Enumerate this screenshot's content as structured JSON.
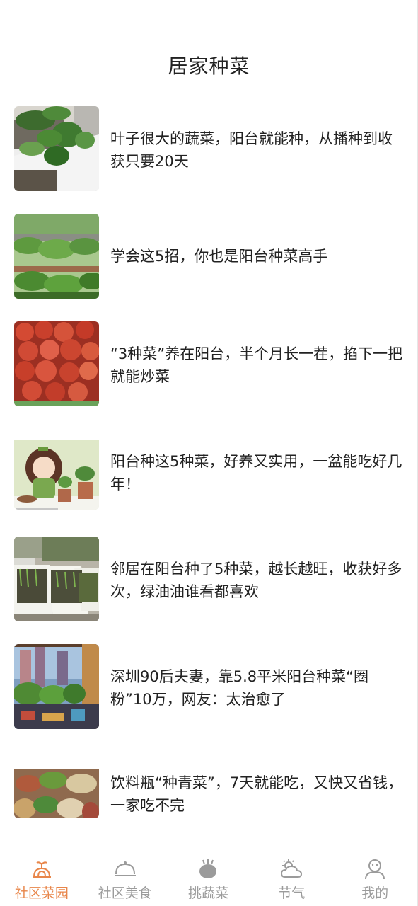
{
  "header": {
    "title": "居家种菜"
  },
  "articles": [
    {
      "title": "叶子很大的蔬菜，阳台就能种，从播种到收获只要20天"
    },
    {
      "title": "学会这5招，你也是阳台种菜高手"
    },
    {
      "title": "“3种菜”养在阳台，半个月长一茬，掐下一把就能炒菜"
    },
    {
      "title": "阳台种这5种菜，好养又实用，一盆能吃好几年！"
    },
    {
      "title": "邻居在阳台种了5种菜，越长越旺，收获好多次，绿油油谁看都喜欢"
    },
    {
      "title": "深圳90后夫妻，靠5.8平米阳台种菜“圈粉”10万，网友：太治愈了"
    },
    {
      "title": "饮料瓶“种青菜”，7天就能吃，又快又省钱，一家吃不完"
    }
  ],
  "tabbar": {
    "active_color": "#e8864a",
    "inactive_color": "#9b9b9b",
    "tabs": [
      {
        "label": "社区菜园",
        "icon": "garden-icon"
      },
      {
        "label": "社区美食",
        "icon": "dish-cover-icon"
      },
      {
        "label": "挑蔬菜",
        "icon": "vegetable-icon"
      },
      {
        "label": "节气",
        "icon": "weather-icon"
      },
      {
        "label": "我的",
        "icon": "profile-icon"
      }
    ]
  }
}
